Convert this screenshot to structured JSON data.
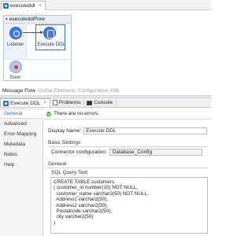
{
  "editor": {
    "tab_label": "executeddl",
    "close": "×"
  },
  "flow": {
    "name": "executeddlFlow",
    "nodes": {
      "listener": "Listener",
      "execute": "Execute DDL",
      "error": "Error"
    }
  },
  "view_tabs": [
    "Message Flow",
    "Global Elements",
    "Configuration XML"
  ],
  "panel_tabs": {
    "component": "Execute DDL",
    "problems": "Problems",
    "console": "Console",
    "close": "×"
  },
  "sidebar": {
    "items": [
      "General",
      "Advanced",
      "Error Mapping",
      "Metadata",
      "Notes",
      "Help"
    ]
  },
  "status": {
    "message": "There are no errors."
  },
  "form": {
    "display_name_label": "Display Name:",
    "display_name_value": "Execute DDL",
    "basic_settings_label": "Basic Settings",
    "connector_label": "Connector configuration:",
    "connector_value": "Database_Config",
    "general_label": "General",
    "sql_label": "SQL Query Text:",
    "sql_lines": [
      "CREATE TABLE customers",
      "( customer_id number(10) NOT NULL,",
      "  customer_name varchar2(50) NOT NULL,",
      "  Address1 varchar2(50),",
      "  Address2 varchar2(50),",
      "  Postalcode varchar2(50),",
      "  city varchar2(50)",
      ")"
    ]
  },
  "colors": {
    "accent": "#2b6fd6",
    "node": "#3f7be3",
    "ok": "#3aa64a"
  }
}
